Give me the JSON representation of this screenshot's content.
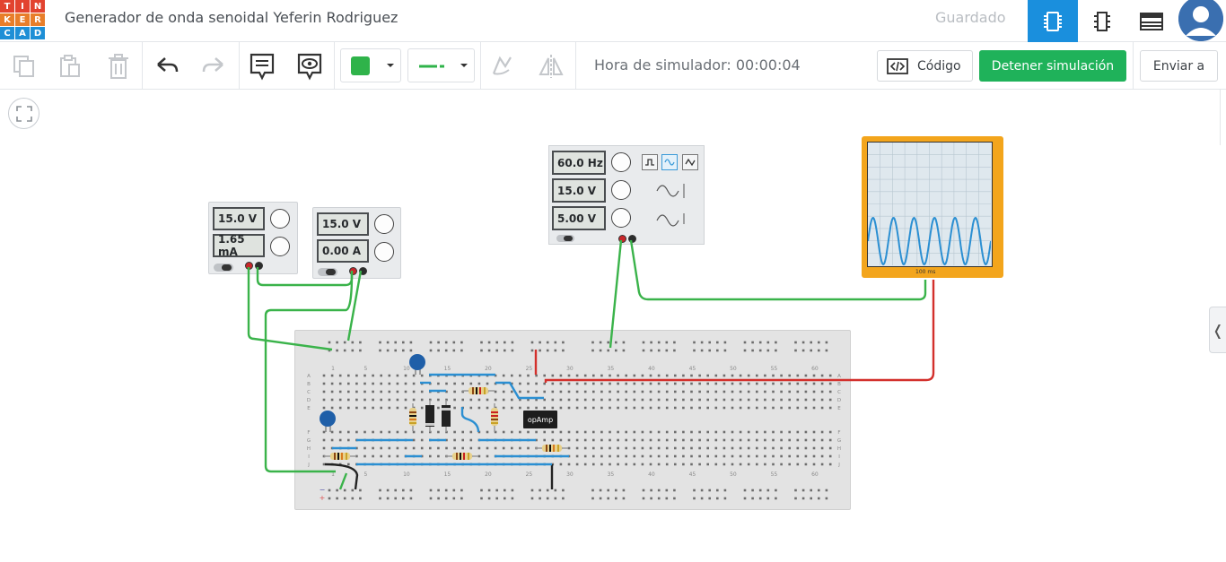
{
  "header": {
    "logo_letters": [
      "T",
      "I",
      "N",
      "K",
      "E",
      "R",
      "C",
      "A",
      "D"
    ],
    "logo_colors": [
      "#e2432f",
      "#e2432f",
      "#e2432f",
      "#e87e2a",
      "#e87e2a",
      "#e87e2a",
      "#1e8fd6",
      "#1e8fd6",
      "#1e8fd6"
    ],
    "project_title": "Generador de onda senoidal Yeferin Rodriguez",
    "save_status": "Guardado",
    "views": [
      {
        "name": "circuit-view",
        "icon": "chip-icon",
        "active": true
      },
      {
        "name": "schematic-view",
        "icon": "schematic-icon",
        "active": false
      },
      {
        "name": "components-list-view",
        "icon": "list-icon",
        "active": false
      }
    ]
  },
  "toolbar": {
    "sim_time_label": "Hora de simulador: 00:00:04",
    "code_label": "Código",
    "stop_label": "Detener simulación",
    "send_label": "Enviar a",
    "wire_color": "#2fb34a",
    "accent": "#1a8fdd",
    "stop_color": "#1fb25a"
  },
  "power_supply_1": {
    "voltage": "15.0 V",
    "current": "1.65 mA"
  },
  "power_supply_2": {
    "voltage": "15.0 V",
    "current": "0.00 A"
  },
  "function_generator": {
    "frequency": "60.0 Hz",
    "amplitude": "15.0 V",
    "offset": "5.00 V",
    "active_wave": "sine"
  },
  "oscilloscope": {
    "time_per_div": "100 ms",
    "cycles_shown": 6
  },
  "breadboard": {
    "top_numbers": [
      "1",
      "5",
      "10",
      "15",
      "20",
      "25",
      "30",
      "35",
      "40",
      "45",
      "50",
      "55",
      "60"
    ],
    "bottom_numbers": [
      "1",
      "5",
      "10",
      "15",
      "20",
      "25",
      "30",
      "35",
      "40",
      "45",
      "50",
      "55",
      "60"
    ],
    "row_letters_top": [
      "A",
      "B",
      "C",
      "D",
      "E"
    ],
    "row_letters_bottom": [
      "F",
      "G",
      "H",
      "I",
      "J"
    ]
  },
  "opamp_label": "opAmp"
}
